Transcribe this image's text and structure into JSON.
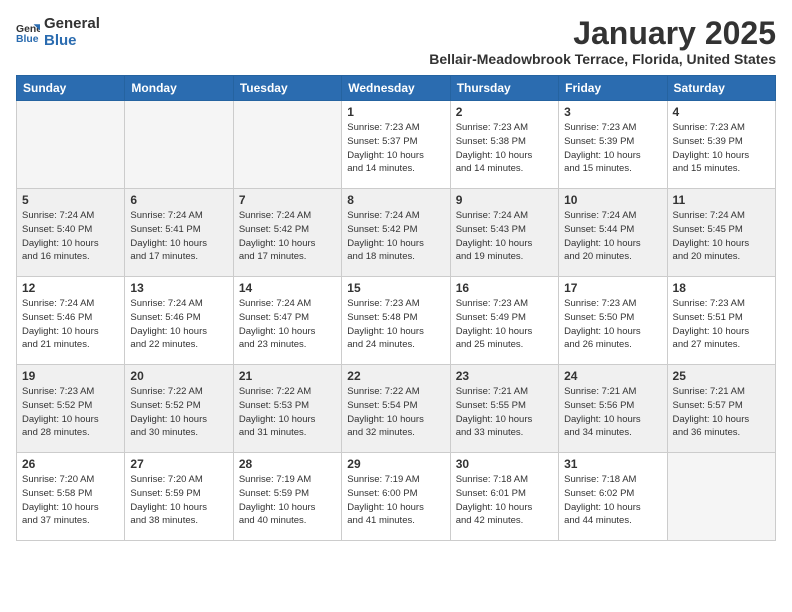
{
  "logo": {
    "text_general": "General",
    "text_blue": "Blue"
  },
  "title": "January 2025",
  "location": "Bellair-Meadowbrook Terrace, Florida, United States",
  "weekdays": [
    "Sunday",
    "Monday",
    "Tuesday",
    "Wednesday",
    "Thursday",
    "Friday",
    "Saturday"
  ],
  "weeks": [
    {
      "shaded": false,
      "days": [
        {
          "num": "",
          "info": ""
        },
        {
          "num": "",
          "info": ""
        },
        {
          "num": "",
          "info": ""
        },
        {
          "num": "1",
          "info": "Sunrise: 7:23 AM\nSunset: 5:37 PM\nDaylight: 10 hours\nand 14 minutes."
        },
        {
          "num": "2",
          "info": "Sunrise: 7:23 AM\nSunset: 5:38 PM\nDaylight: 10 hours\nand 14 minutes."
        },
        {
          "num": "3",
          "info": "Sunrise: 7:23 AM\nSunset: 5:39 PM\nDaylight: 10 hours\nand 15 minutes."
        },
        {
          "num": "4",
          "info": "Sunrise: 7:23 AM\nSunset: 5:39 PM\nDaylight: 10 hours\nand 15 minutes."
        }
      ]
    },
    {
      "shaded": true,
      "days": [
        {
          "num": "5",
          "info": "Sunrise: 7:24 AM\nSunset: 5:40 PM\nDaylight: 10 hours\nand 16 minutes."
        },
        {
          "num": "6",
          "info": "Sunrise: 7:24 AM\nSunset: 5:41 PM\nDaylight: 10 hours\nand 17 minutes."
        },
        {
          "num": "7",
          "info": "Sunrise: 7:24 AM\nSunset: 5:42 PM\nDaylight: 10 hours\nand 17 minutes."
        },
        {
          "num": "8",
          "info": "Sunrise: 7:24 AM\nSunset: 5:42 PM\nDaylight: 10 hours\nand 18 minutes."
        },
        {
          "num": "9",
          "info": "Sunrise: 7:24 AM\nSunset: 5:43 PM\nDaylight: 10 hours\nand 19 minutes."
        },
        {
          "num": "10",
          "info": "Sunrise: 7:24 AM\nSunset: 5:44 PM\nDaylight: 10 hours\nand 20 minutes."
        },
        {
          "num": "11",
          "info": "Sunrise: 7:24 AM\nSunset: 5:45 PM\nDaylight: 10 hours\nand 20 minutes."
        }
      ]
    },
    {
      "shaded": false,
      "days": [
        {
          "num": "12",
          "info": "Sunrise: 7:24 AM\nSunset: 5:46 PM\nDaylight: 10 hours\nand 21 minutes."
        },
        {
          "num": "13",
          "info": "Sunrise: 7:24 AM\nSunset: 5:46 PM\nDaylight: 10 hours\nand 22 minutes."
        },
        {
          "num": "14",
          "info": "Sunrise: 7:24 AM\nSunset: 5:47 PM\nDaylight: 10 hours\nand 23 minutes."
        },
        {
          "num": "15",
          "info": "Sunrise: 7:23 AM\nSunset: 5:48 PM\nDaylight: 10 hours\nand 24 minutes."
        },
        {
          "num": "16",
          "info": "Sunrise: 7:23 AM\nSunset: 5:49 PM\nDaylight: 10 hours\nand 25 minutes."
        },
        {
          "num": "17",
          "info": "Sunrise: 7:23 AM\nSunset: 5:50 PM\nDaylight: 10 hours\nand 26 minutes."
        },
        {
          "num": "18",
          "info": "Sunrise: 7:23 AM\nSunset: 5:51 PM\nDaylight: 10 hours\nand 27 minutes."
        }
      ]
    },
    {
      "shaded": true,
      "days": [
        {
          "num": "19",
          "info": "Sunrise: 7:23 AM\nSunset: 5:52 PM\nDaylight: 10 hours\nand 28 minutes."
        },
        {
          "num": "20",
          "info": "Sunrise: 7:22 AM\nSunset: 5:52 PM\nDaylight: 10 hours\nand 30 minutes."
        },
        {
          "num": "21",
          "info": "Sunrise: 7:22 AM\nSunset: 5:53 PM\nDaylight: 10 hours\nand 31 minutes."
        },
        {
          "num": "22",
          "info": "Sunrise: 7:22 AM\nSunset: 5:54 PM\nDaylight: 10 hours\nand 32 minutes."
        },
        {
          "num": "23",
          "info": "Sunrise: 7:21 AM\nSunset: 5:55 PM\nDaylight: 10 hours\nand 33 minutes."
        },
        {
          "num": "24",
          "info": "Sunrise: 7:21 AM\nSunset: 5:56 PM\nDaylight: 10 hours\nand 34 minutes."
        },
        {
          "num": "25",
          "info": "Sunrise: 7:21 AM\nSunset: 5:57 PM\nDaylight: 10 hours\nand 36 minutes."
        }
      ]
    },
    {
      "shaded": false,
      "days": [
        {
          "num": "26",
          "info": "Sunrise: 7:20 AM\nSunset: 5:58 PM\nDaylight: 10 hours\nand 37 minutes."
        },
        {
          "num": "27",
          "info": "Sunrise: 7:20 AM\nSunset: 5:59 PM\nDaylight: 10 hours\nand 38 minutes."
        },
        {
          "num": "28",
          "info": "Sunrise: 7:19 AM\nSunset: 5:59 PM\nDaylight: 10 hours\nand 40 minutes."
        },
        {
          "num": "29",
          "info": "Sunrise: 7:19 AM\nSunset: 6:00 PM\nDaylight: 10 hours\nand 41 minutes."
        },
        {
          "num": "30",
          "info": "Sunrise: 7:18 AM\nSunset: 6:01 PM\nDaylight: 10 hours\nand 42 minutes."
        },
        {
          "num": "31",
          "info": "Sunrise: 7:18 AM\nSunset: 6:02 PM\nDaylight: 10 hours\nand 44 minutes."
        },
        {
          "num": "",
          "info": ""
        }
      ]
    }
  ]
}
